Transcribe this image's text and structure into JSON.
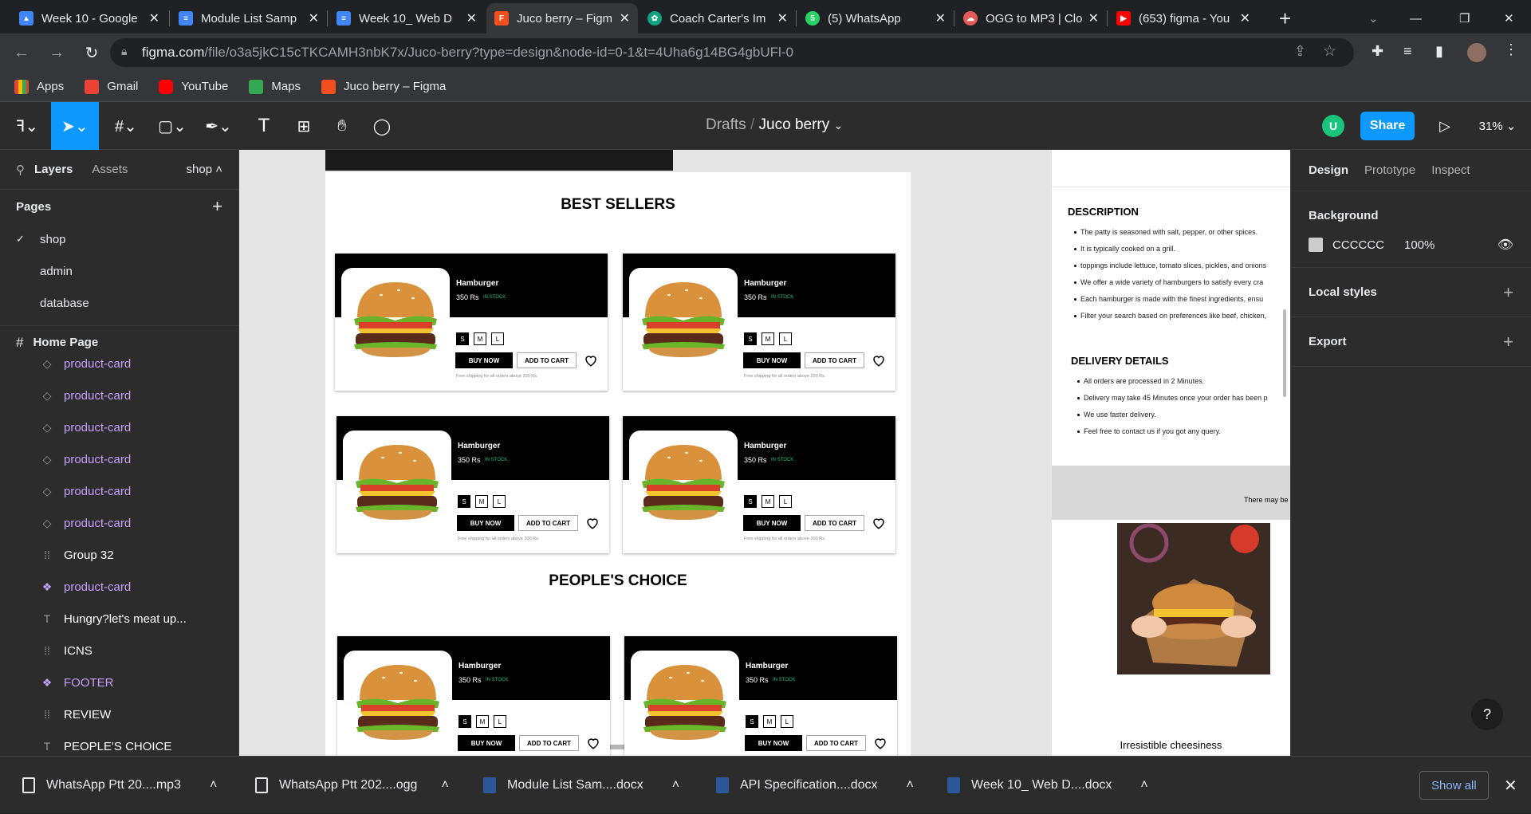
{
  "browser": {
    "tabs": [
      {
        "title": "Week 10 - Google",
        "icon": "google-drive-icon",
        "color": "#4285f4"
      },
      {
        "title": "Module List Samp",
        "icon": "google-docs-icon",
        "color": "#4285f4"
      },
      {
        "title": "Week 10_ Web D",
        "icon": "google-docs-icon",
        "color": "#4285f4"
      },
      {
        "title": "Juco berry – Figm",
        "icon": "figma-icon",
        "color": "#f24e1e",
        "active": true
      },
      {
        "title": "Coach Carter's Im",
        "icon": "chatgpt-icon",
        "color": "#10a37f"
      },
      {
        "title": "(5) WhatsApp",
        "icon": "whatsapp-icon",
        "color": "#25d366"
      },
      {
        "title": "OGG to MP3 | Clo",
        "icon": "cloudconvert-icon",
        "color": "#e25b5b"
      },
      {
        "title": "(653) figma - You",
        "icon": "youtube-icon",
        "color": "#ff0000"
      }
    ],
    "new_tab": "+",
    "url_host": "figma.com",
    "url_path": "/file/o3a5jkC15cTKCAMH3nbK7x/Juco-berry?type=design&node-id=0-1&t=4Uha6g14BG4gbUFl-0",
    "bookmarks": [
      {
        "label": "Apps",
        "icon": "apps-grid-icon",
        "color": "#5f6368"
      },
      {
        "label": "Gmail",
        "icon": "gmail-icon",
        "color": "#ea4335"
      },
      {
        "label": "YouTube",
        "icon": "youtube-icon",
        "color": "#ff0000"
      },
      {
        "label": "Maps",
        "icon": "maps-icon",
        "color": "#34a853"
      },
      {
        "label": "Juco berry – Figma",
        "icon": "figma-icon",
        "color": "#f24e1e"
      }
    ]
  },
  "figma": {
    "breadcrumb_folder": "Drafts",
    "breadcrumb_sep": "/",
    "file_name": "Juco berry",
    "user_initial": "U",
    "share_label": "Share",
    "zoom": "31%",
    "left_tabs": {
      "layers": "Layers",
      "assets": "Assets",
      "page_select": "shop"
    },
    "pages_title": "Pages",
    "pages": [
      {
        "name": "shop",
        "current": true
      },
      {
        "name": "admin"
      },
      {
        "name": "database"
      }
    ],
    "layers_title": "Home Page",
    "layers": [
      {
        "name": "product-card",
        "type": "instance"
      },
      {
        "name": "product-card",
        "type": "instance"
      },
      {
        "name": "product-card",
        "type": "instance"
      },
      {
        "name": "product-card",
        "type": "instance"
      },
      {
        "name": "product-card",
        "type": "instance"
      },
      {
        "name": "product-card",
        "type": "instance"
      },
      {
        "name": "Group 32",
        "type": "group"
      },
      {
        "name": "product-card",
        "type": "component"
      },
      {
        "name": "Hungry?let's meat up...",
        "type": "text"
      },
      {
        "name": "ICNS",
        "type": "group"
      },
      {
        "name": "FOOTER",
        "type": "component"
      },
      {
        "name": "REVIEW",
        "type": "group"
      },
      {
        "name": "PEOPLE'S CHOICE",
        "type": "text"
      }
    ],
    "right_tabs": {
      "design": "Design",
      "prototype": "Prototype",
      "inspect": "Inspect"
    },
    "background_title": "Background",
    "background_color": "CCCCCC",
    "background_opacity": "100%",
    "local_styles": "Local styles",
    "export": "Export",
    "help": "?"
  },
  "design": {
    "best_sellers": "BEST SELLERS",
    "peoples_choice": "PEOPLE'S CHOICE",
    "card": {
      "name": "Hamburger",
      "price": "350 Rs",
      "stock": "IN STOCK",
      "sizes": [
        "S",
        "M",
        "L"
      ],
      "buy": "BUY NOW",
      "cart": "ADD TO CART",
      "shipping": "Free shipping for all orders above 200 Rs."
    },
    "description_title": "DESCRIPTION",
    "description": [
      "The patty is seasoned with salt, pepper, or other spices.",
      "It is typically cooked on a grill.",
      "toppings include lettuce, tomato slices, pickles, and onions",
      "We offer a wide variety of hamburgers to satisfy every cra",
      "Each hamburger is made with the finest ingredients, ensu",
      "Filter your search based on preferences like beef, chicken,"
    ],
    "delivery_title": "DELIVERY DETAILS",
    "delivery": [
      "All orders are processed in 2 Minutes.",
      "Delivery may take 45 Minutes once your order has been p",
      "We use faster delivery.",
      "Feel free to contact us if you got any query."
    ],
    "review_snippet": "There may be",
    "review_caption": "Irresistible cheesiness"
  },
  "downloads": {
    "items": [
      {
        "name": "WhatsApp Ptt 20....mp3",
        "icon": "audio-file-icon",
        "color": "#e8eaed"
      },
      {
        "name": "WhatsApp Ptt 202....ogg",
        "icon": "audio-file-icon",
        "color": "#e8eaed"
      },
      {
        "name": "Module List Sam....docx",
        "icon": "word-doc-icon",
        "color": "#2b579a"
      },
      {
        "name": "API Specification....docx",
        "icon": "word-doc-icon",
        "color": "#2b579a"
      },
      {
        "name": "Week 10_ Web D....docx",
        "icon": "word-doc-icon",
        "color": "#2b579a"
      }
    ],
    "show_all": "Show all"
  }
}
